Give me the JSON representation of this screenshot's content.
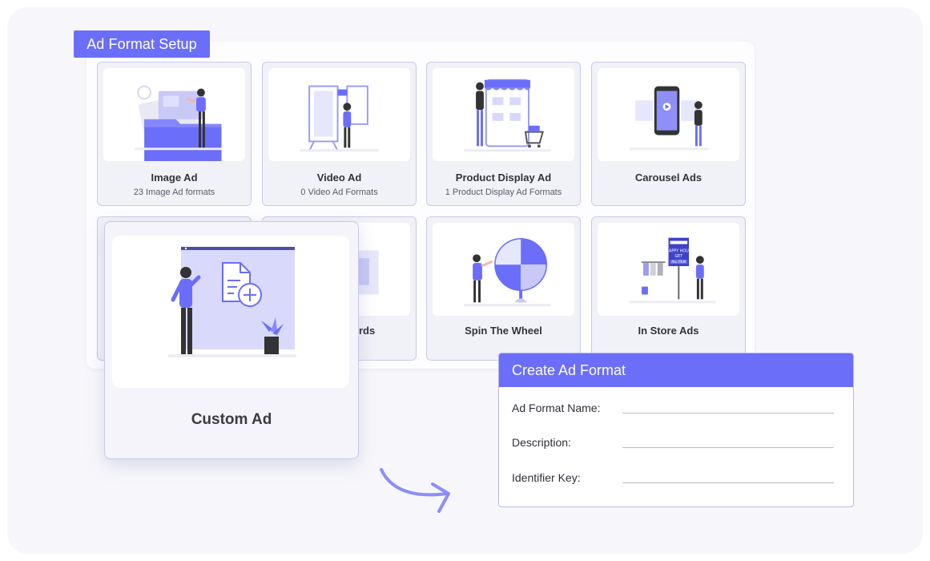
{
  "setup": {
    "title": "Ad Format Setup"
  },
  "cards": [
    {
      "id": "image",
      "title": "Image Ad",
      "sub": "23 Image Ad formats"
    },
    {
      "id": "video",
      "title": "Video Ad",
      "sub": "0 Video Ad Formats"
    },
    {
      "id": "product",
      "title": "Product Display Ad",
      "sub": "1 Product Display Ad Formats"
    },
    {
      "id": "carousel",
      "title": "Carousel Ads",
      "sub": ""
    },
    {
      "id": "cards",
      "title_fragment": "rds"
    },
    {
      "id": "spin",
      "title": "Spin The Wheel"
    },
    {
      "id": "instore",
      "title": "In Store Ads",
      "poster_text": "HAPPY HOUR / GET / ALL ITEM"
    }
  ],
  "custom_card": {
    "title": "Custom Ad"
  },
  "create_form": {
    "title": "Create Ad Format",
    "fields": [
      {
        "label": "Ad Format Name:",
        "value": ""
      },
      {
        "label": "Description:",
        "value": ""
      },
      {
        "label": "Identifier Key:",
        "value": ""
      }
    ]
  },
  "colors": {
    "accent": "#6b6ef8",
    "border": "#c9c9ea",
    "panel": "#f7f7fb"
  }
}
